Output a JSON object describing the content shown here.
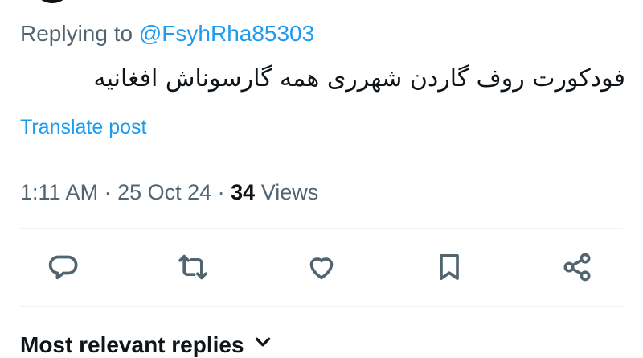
{
  "post": {
    "replying_prefix": "Replying to ",
    "replying_handle": "@FsyhRha85303",
    "text": "فودکورت روف گاردن شهرری همه گارسوناش افغانیه",
    "translate_label": "Translate post",
    "time": "1:11 AM",
    "separator": " · ",
    "date": "25 Oct 24",
    "views_count": "34",
    "views_label": " Views"
  },
  "actions": {
    "reply_icon": "reply-icon",
    "retweet_icon": "retweet-icon",
    "like_icon": "heart-icon",
    "bookmark_icon": "bookmark-icon",
    "share_icon": "share-icon"
  },
  "replies": {
    "sort_label": "Most relevant replies"
  },
  "colors": {
    "accent": "#1d9bf0",
    "muted": "#536471",
    "text": "#0f1419",
    "divider": "#eff3f4"
  }
}
